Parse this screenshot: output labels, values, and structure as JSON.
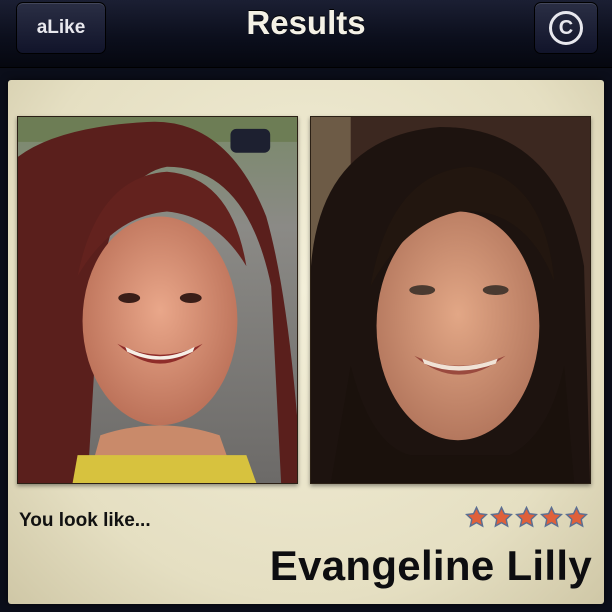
{
  "navbar": {
    "back_label": "aLike",
    "title": "Results",
    "info_icon": "copyright-icon",
    "info_glyph": "C"
  },
  "result": {
    "caption": "You look like...",
    "match_name": "Evangeline Lilly",
    "rating": 5,
    "rating_max": 5,
    "star_color": "#e0603a"
  },
  "photos": {
    "user": "user-portrait-photo",
    "match": "celebrity-portrait-photo"
  }
}
